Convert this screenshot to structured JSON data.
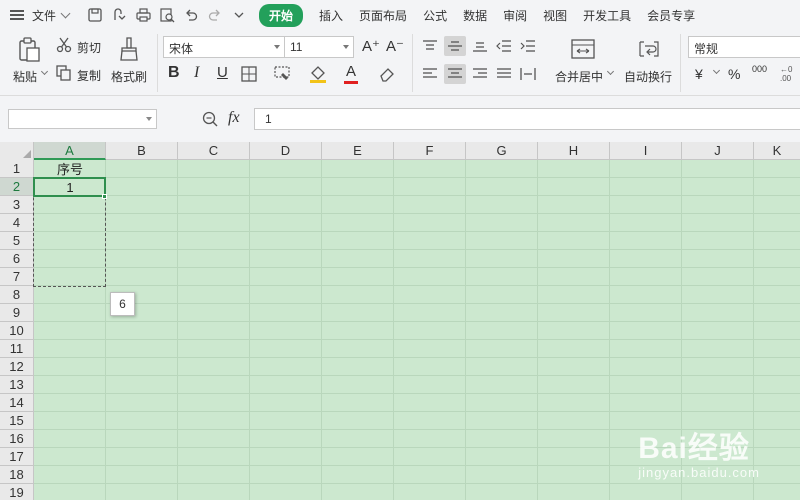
{
  "menu": {
    "file_label": "文件",
    "tabs": [
      {
        "label": "开始",
        "active": true
      },
      {
        "label": "插入",
        "active": false
      },
      {
        "label": "页面布局",
        "active": false
      },
      {
        "label": "公式",
        "active": false
      },
      {
        "label": "数据",
        "active": false
      },
      {
        "label": "审阅",
        "active": false
      },
      {
        "label": "视图",
        "active": false
      },
      {
        "label": "开发工具",
        "active": false
      },
      {
        "label": "会员专享",
        "active": false
      }
    ]
  },
  "ribbon": {
    "paste_label": "粘贴",
    "cut_label": "剪切",
    "copy_label": "复制",
    "format_painter_label": "格式刷",
    "font_name": "宋体",
    "font_size": "11",
    "merge_center_label": "合并居中",
    "auto_wrap_label": "自动换行",
    "number_format": "常规",
    "currency_symbol": "¥",
    "percent_symbol": "%",
    "thousands_symbol": "000",
    "bold_glyph": "B",
    "italic_glyph": "I",
    "underline_glyph": "U",
    "font_grow_glyph": "A⁺",
    "font_shrink_glyph": "A⁻",
    "font_color_glyph": "A"
  },
  "formula_bar": {
    "name_box_value": "",
    "fx_label": "fx",
    "formula_value": "1"
  },
  "sheet": {
    "columns": [
      "A",
      "B",
      "C",
      "D",
      "E",
      "F",
      "G",
      "H",
      "I",
      "J",
      "K"
    ],
    "rows": [
      "1",
      "2",
      "3",
      "4",
      "5",
      "6",
      "7",
      "8",
      "9",
      "10",
      "11",
      "12",
      "13",
      "14",
      "15",
      "16",
      "17",
      "18",
      "19"
    ],
    "selected_column": "A",
    "selected_row": "2",
    "cells": {
      "A1": "序号",
      "A2": "1"
    },
    "fill_tooltip": "6"
  },
  "watermark": {
    "main": "Bai经验",
    "sub": "jingyan.baidu.com"
  },
  "colors": {
    "accent": "#23a05b",
    "sheet_background": "#cce8cf",
    "active_cell_border": "#2f8f4e"
  }
}
